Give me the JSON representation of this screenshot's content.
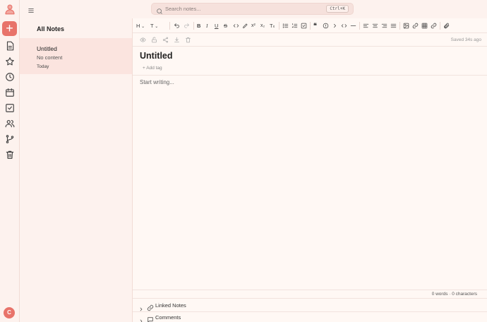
{
  "search": {
    "placeholder": "Search notes...",
    "shortcut": "Ctrl+K"
  },
  "notes_list": {
    "title": "All Notes",
    "items": [
      {
        "title": "Untitled",
        "preview": "No content",
        "date": "Today"
      }
    ]
  },
  "toolbar": {
    "heading_label": "H"
  },
  "editor": {
    "saved_status": "Saved 34s ago",
    "title": "Untitled",
    "add_tag": "+ Add tag",
    "body_placeholder": "Start writing...",
    "counts": "0 words · 0 characters"
  },
  "panels": {
    "linked_notes": "Linked Notes",
    "comments": "Comments"
  },
  "user": {
    "avatar_initial": "C"
  },
  "colors": {
    "accent": "#e8736a",
    "sidebar_bg": "#fdf2ee",
    "selected_bg": "#fbe4df",
    "editor_bg": "#fff8f4"
  }
}
